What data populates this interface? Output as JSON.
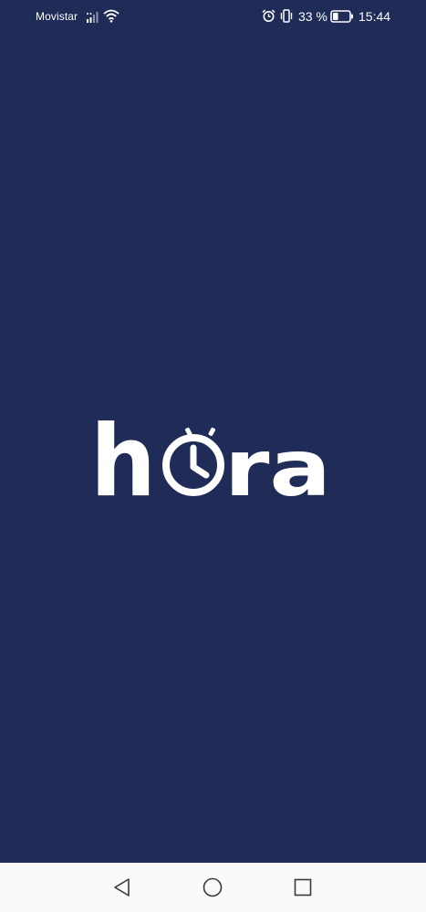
{
  "status_bar": {
    "carrier": "Movistar",
    "battery_percent": "33 %",
    "battery_level": 0.33,
    "time": "15:44",
    "icons": [
      "signal-icon",
      "wifi-icon",
      "alarm-icon",
      "vibrate-icon",
      "battery-icon"
    ]
  },
  "splash": {
    "logo_text": "hora",
    "logo_icon": "stopwatch-icon",
    "background_color": "#1f2c57",
    "logo_color": "#ffffff"
  },
  "nav_bar": {
    "buttons": [
      "back-icon",
      "home-icon",
      "recents-icon"
    ],
    "background_color": "#fafafa"
  }
}
